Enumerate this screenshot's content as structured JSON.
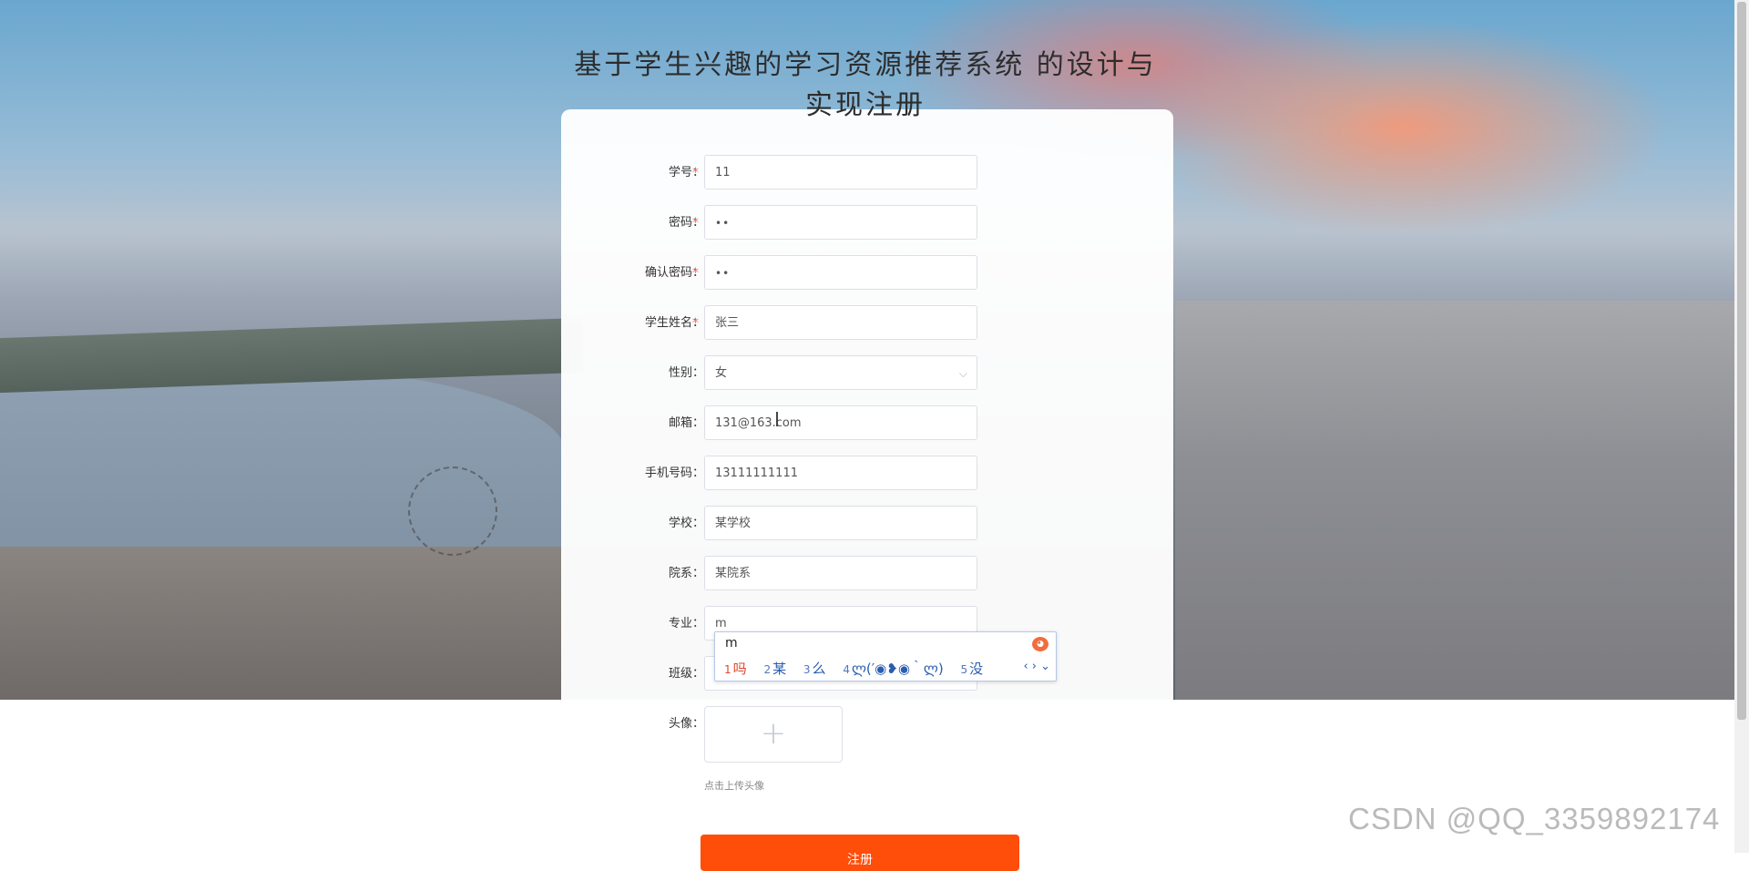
{
  "page": {
    "title": "基于学生兴趣的学习资源推荐系统 的设计与实现注册"
  },
  "form": {
    "fields": [
      {
        "label": "学号：",
        "required": true,
        "value": "11"
      },
      {
        "label": "密码：",
        "required": true,
        "value": "••"
      },
      {
        "label": "确认密码：",
        "required": true,
        "value": "••"
      },
      {
        "label": "学生姓名：",
        "required": true,
        "value": "张三"
      },
      {
        "label": "性别：",
        "required": false,
        "value": "女"
      },
      {
        "label": "邮箱：",
        "required": false,
        "value": "131@163.com"
      },
      {
        "label": "手机号码：",
        "required": false,
        "value": "13111111111"
      },
      {
        "label": "学校：",
        "required": false,
        "value": "某学校"
      },
      {
        "label": "院系：",
        "required": false,
        "value": "某院系"
      },
      {
        "label": "专业：",
        "required": false,
        "value": "m"
      },
      {
        "label": "班级：",
        "required": false,
        "value": ""
      }
    ],
    "required_mark": "*",
    "avatar_label": "头像：",
    "avatar_plus": "+",
    "avatar_hint": "点击上传头像",
    "submit_label": "注册"
  },
  "ime": {
    "composition": "m",
    "candidates": [
      {
        "n": "1",
        "c": "吗"
      },
      {
        "n": "2",
        "c": "某"
      },
      {
        "n": "3",
        "c": "么"
      },
      {
        "n": "4",
        "c": "ლ(′◉❥◉｀ლ)"
      },
      {
        "n": "5",
        "c": "没"
      }
    ],
    "nav": "‹ › ⌄"
  },
  "icons": {
    "select_chevron": "chevron-down-icon",
    "upload": "plus-icon",
    "ime_logo": "ime-logo-icon"
  },
  "watermark": "CSDN @QQ_3359892174",
  "colors": {
    "required": "#f56c6c",
    "submit_bg": "#ff4d0a",
    "ime_candidate": "#2a5db0",
    "ime_first": "#e0462c"
  }
}
